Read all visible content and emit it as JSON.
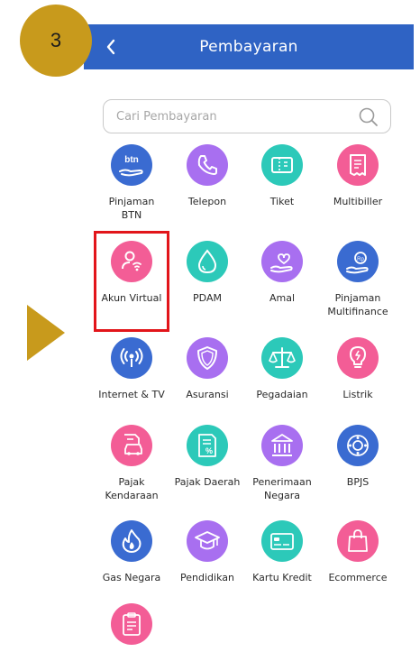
{
  "step_badge": "3",
  "header": {
    "title": "Pembayaran",
    "back_icon": "chevron-left-icon"
  },
  "search": {
    "placeholder": "Cari Pembayaran",
    "value": ""
  },
  "colors": {
    "header": "#2f63c4",
    "badge": "#c89a1c",
    "highlight": "#e2151a"
  },
  "tiles": [
    {
      "label": "Pinjaman\nBTN",
      "icon": "btn-hand-icon",
      "color": "#3a6bd1"
    },
    {
      "label": "Telepon",
      "icon": "phone-icon",
      "color": "#a86ff0"
    },
    {
      "label": "Tiket",
      "icon": "ticket-icon",
      "color": "#2cc9b9"
    },
    {
      "label": "Multibiller",
      "icon": "receipt-icon",
      "color": "#f35d96"
    },
    {
      "label": "Akun Virtual",
      "icon": "virtual-account-icon",
      "color": "#f35d96"
    },
    {
      "label": "PDAM",
      "icon": "water-drop-icon",
      "color": "#2cc9b9"
    },
    {
      "label": "Amal",
      "icon": "charity-heart-icon",
      "color": "#a86ff0"
    },
    {
      "label": "Pinjaman\nMultifinance",
      "icon": "loan-hand-icon",
      "color": "#3a6bd1"
    },
    {
      "label": "Internet & TV",
      "icon": "broadcast-icon",
      "color": "#3a6bd1"
    },
    {
      "label": "Asuransi",
      "icon": "shield-icon",
      "color": "#a86ff0"
    },
    {
      "label": "Pegadaian",
      "icon": "scale-icon",
      "color": "#2cc9b9"
    },
    {
      "label": "Listrik",
      "icon": "lightbulb-icon",
      "color": "#f35d96"
    },
    {
      "label": "Pajak\nKendaraan",
      "icon": "car-tax-icon",
      "color": "#f35d96"
    },
    {
      "label": "Pajak Daerah",
      "icon": "tax-document-icon",
      "color": "#2cc9b9"
    },
    {
      "label": "Penerimaan\nNegara",
      "icon": "government-building-icon",
      "color": "#a86ff0"
    },
    {
      "label": "BPJS",
      "icon": "bpjs-icon",
      "color": "#3a6bd1"
    },
    {
      "label": "Gas Negara",
      "icon": "flame-icon",
      "color": "#3a6bd1"
    },
    {
      "label": "Pendidikan",
      "icon": "graduation-cap-icon",
      "color": "#a86ff0"
    },
    {
      "label": "Kartu Kredit",
      "icon": "credit-card-icon",
      "color": "#2cc9b9"
    },
    {
      "label": "Ecommerce",
      "icon": "shopping-bag-icon",
      "color": "#f35d96"
    },
    {
      "label": "",
      "icon": "clipboard-icon",
      "color": "#f35d96"
    }
  ]
}
